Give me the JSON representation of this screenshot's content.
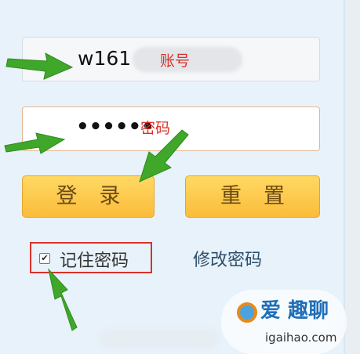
{
  "login_form": {
    "username_value": "w161",
    "username_annotation": "账号",
    "password_value": "••••••",
    "password_annotation": "密码",
    "login_button": "登录",
    "reset_button": "重置",
    "remember_checked": true,
    "remember_label": "记住密码",
    "change_password_link": "修改密码"
  },
  "watermark": {
    "text": "爱 趣聊",
    "url": "igaihao.com"
  },
  "colors": {
    "annotation_red": "#d8322a",
    "arrow_green": "#3fa82a",
    "button_orange": "#fbbc3a"
  }
}
